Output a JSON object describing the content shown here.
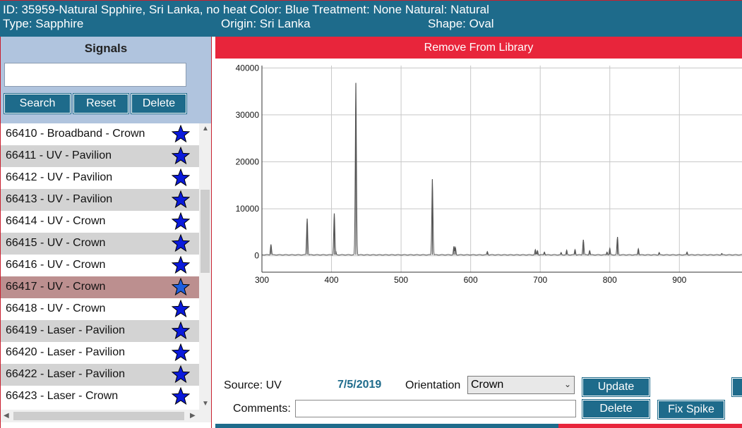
{
  "header": {
    "line1": "ID: 35959-Natural Spphire, Sri Lanka, no heat Color: Blue Treatment: None Natural: Natural",
    "type": "Type: Sapphire",
    "origin": "Origin: Sri Lanka",
    "shape": "Shape: Oval"
  },
  "signals": {
    "title": "Signals",
    "search_value": "",
    "buttons": {
      "search": "Search",
      "reset": "Reset",
      "delete": "Delete"
    },
    "items": [
      {
        "label": "66410 - Broadband - Crown"
      },
      {
        "label": "66411 - UV - Pavilion"
      },
      {
        "label": "66412 - UV - Pavilion"
      },
      {
        "label": "66413 - UV - Pavilion"
      },
      {
        "label": "66414 - UV - Crown"
      },
      {
        "label": "66415 - UV - Crown"
      },
      {
        "label": "66416 - UV - Crown"
      },
      {
        "label": "66417 - UV - Crown"
      },
      {
        "label": "66418 - UV - Crown"
      },
      {
        "label": "66419 - Laser - Pavilion"
      },
      {
        "label": "66420 - Laser - Pavilion"
      },
      {
        "label": "66422 - Laser - Pavilion"
      },
      {
        "label": "66423 - Laser - Crown"
      }
    ],
    "selected_index": 7,
    "star_icon": "star-icon",
    "colors": {
      "row_alt": "#d3d3d3",
      "row_selected": "#bc8f8f",
      "star": "#0a1adb",
      "star_selected": "#1e5fe0"
    }
  },
  "main": {
    "remove_label": "Remove From Library",
    "source_label": "Source: UV",
    "date": "7/5/2019",
    "orientation_label": "Orientation",
    "orientation_value": "Crown",
    "update_label": "Update",
    "delete_label": "Delete",
    "fix_spike_label": "Fix Spike",
    "comments_label": "Comments:",
    "comments_value": ""
  },
  "colors": {
    "header_bg": "#1e6b8b",
    "accent_red": "#e8253b",
    "panel_bg": "#b0c4de",
    "date_text": "#1e6b8b"
  },
  "chart_data": {
    "type": "line",
    "title": "",
    "xlabel": "",
    "ylabel": "",
    "xlim": [
      300,
      990
    ],
    "ylim": [
      -3500,
      40500
    ],
    "grid": true,
    "xticks": [
      300,
      400,
      500,
      600,
      700,
      800,
      900
    ],
    "yticks": [
      0,
      10000,
      20000,
      30000,
      40000
    ],
    "baseline": 200,
    "peaks": [
      {
        "x": 313,
        "y": 2400
      },
      {
        "x": 365,
        "y": 7900
      },
      {
        "x": 404,
        "y": 9000
      },
      {
        "x": 406,
        "y": 1000
      },
      {
        "x": 435,
        "y": 36800
      },
      {
        "x": 545,
        "y": 16300
      },
      {
        "x": 576,
        "y": 2000
      },
      {
        "x": 578,
        "y": 1800
      },
      {
        "x": 624,
        "y": 900
      },
      {
        "x": 693,
        "y": 1300
      },
      {
        "x": 696,
        "y": 1100
      },
      {
        "x": 706,
        "y": 800
      },
      {
        "x": 730,
        "y": 700
      },
      {
        "x": 738,
        "y": 1200
      },
      {
        "x": 750,
        "y": 1300
      },
      {
        "x": 762,
        "y": 3400
      },
      {
        "x": 771,
        "y": 1100
      },
      {
        "x": 796,
        "y": 800
      },
      {
        "x": 800,
        "y": 1600
      },
      {
        "x": 811,
        "y": 4000
      },
      {
        "x": 841,
        "y": 1500
      },
      {
        "x": 871,
        "y": 700
      },
      {
        "x": 911,
        "y": 800
      },
      {
        "x": 961,
        "y": 500
      }
    ]
  }
}
